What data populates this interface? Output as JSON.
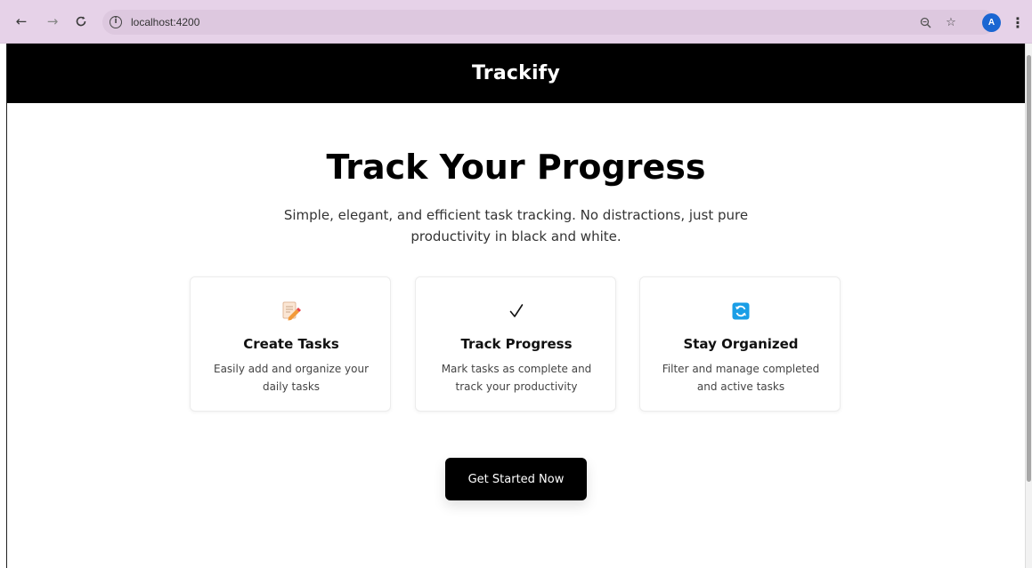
{
  "browser": {
    "back_icon": "arrow-left-icon",
    "forward_icon": "arrow-right-icon",
    "reload_icon": "reload-icon",
    "url": "localhost:4200",
    "avatar_letter": "A"
  },
  "app": {
    "title": "Trackify"
  },
  "hero": {
    "title": "Track Your Progress",
    "subtitle": "Simple, elegant, and efficient task tracking. No distractions, just pure productivity in black and white."
  },
  "features": [
    {
      "icon": "memo-pencil-icon",
      "title": "Create Tasks",
      "description": "Easily add and organize your daily tasks"
    },
    {
      "icon": "checkmark-icon",
      "title": "Track Progress",
      "description": "Mark tasks as complete and track your productivity"
    },
    {
      "icon": "refresh-arrows-icon",
      "title": "Stay Organized",
      "description": "Filter and manage completed and active tasks"
    }
  ],
  "cta": {
    "label": "Get Started Now"
  },
  "colors": {
    "header_bg": "#000000",
    "browser_bar": "#e6d2e8",
    "button_bg": "#000000",
    "organized_icon": "#1a9ee6"
  }
}
